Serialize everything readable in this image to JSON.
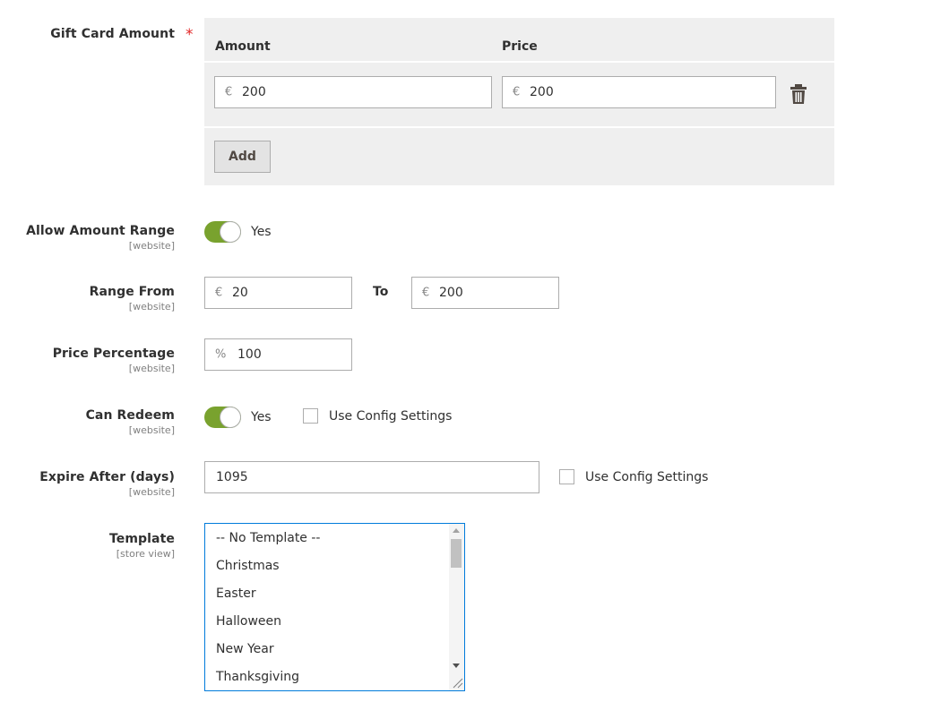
{
  "gift_card_amount": {
    "label": "Gift Card Amount",
    "required_mark": "*",
    "columns": {
      "amount": "Amount",
      "price": "Price"
    },
    "rows": [
      {
        "amount_prefix": "€",
        "amount": "200",
        "price_prefix": "€",
        "price": "200"
      }
    ],
    "add_label": "Add",
    "delete_icon": "trash-icon"
  },
  "allow_amount_range": {
    "label": "Allow Amount Range",
    "scope": "[website]",
    "state": "Yes"
  },
  "range": {
    "label": "Range From",
    "scope": "[website]",
    "from_prefix": "€",
    "from": "20",
    "to_label": "To",
    "to_prefix": "€",
    "to": "200"
  },
  "price_percentage": {
    "label": "Price Percentage",
    "scope": "[website]",
    "prefix": "%",
    "value": "100"
  },
  "can_redeem": {
    "label": "Can Redeem",
    "scope": "[website]",
    "state": "Yes",
    "use_config_label": "Use Config Settings"
  },
  "expire_after": {
    "label": "Expire After (days)",
    "scope": "[website]",
    "value": "1095",
    "use_config_label": "Use Config Settings"
  },
  "template": {
    "label": "Template",
    "scope": "[store view]",
    "options": [
      "-- No Template --",
      "Christmas",
      "Easter",
      "Halloween",
      "New Year",
      "Thanksgiving"
    ]
  },
  "colors": {
    "toggle_on": "#79a22e",
    "required": "#e22626",
    "focus_border": "#007bdb"
  }
}
